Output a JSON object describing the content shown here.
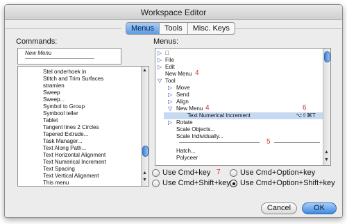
{
  "window": {
    "title": "Workspace Editor"
  },
  "tabs": [
    {
      "label": "Menus"
    },
    {
      "label": "Tools"
    },
    {
      "label": "Misc. Keys"
    }
  ],
  "commands": {
    "label": "Commands:",
    "new_menu": "New Menu",
    "items": [
      "Stel onderhoek in",
      "Stitch and Trim Surfaces",
      "stramien",
      "Sweep",
      "Sweep...",
      "Symbol to Group",
      "Symbool teller",
      "Tablet",
      "Tangent lines 2 Circles",
      "Tapered Extrude...",
      "Task Manager...",
      "Text Along Path...",
      "Text Horizontal Alignment",
      "Text Numerical Increment",
      "Text Spacing",
      "Text Vertical Alignment",
      "This menu"
    ]
  },
  "menus": {
    "label": "Menus:",
    "items": [
      {
        "text": "",
        "arrow": "right"
      },
      {
        "text": "File",
        "arrow": "right"
      },
      {
        "text": "Edit",
        "arrow": "right"
      },
      {
        "text": "New Menu",
        "marker": "4"
      },
      {
        "text": "Tool",
        "arrow": "down"
      },
      {
        "text": "Move",
        "arrow": "right"
      },
      {
        "text": "Send",
        "arrow": "right"
      },
      {
        "text": "Align",
        "arrow": "right"
      },
      {
        "text": "New Menu",
        "arrow": "down",
        "marker": "4"
      },
      {
        "text": "Text Numerical Increment",
        "shortcut": "⌥⇧⌘T",
        "marker": "6"
      },
      {
        "text": "Rotate",
        "arrow": "right"
      },
      {
        "text": "Scale Objects..."
      },
      {
        "text": "Scale Individually..."
      },
      {
        "separator": true,
        "marker": "5"
      },
      {
        "text": "Hatch..."
      },
      {
        "text": "Polyceer"
      }
    ]
  },
  "radios": {
    "marker": "7",
    "options": [
      {
        "label": "Use Cmd+key",
        "selected": false
      },
      {
        "label": "Use Cmd+Option+key",
        "selected": false
      },
      {
        "label": "Use Cmd+Shift+key",
        "selected": false
      },
      {
        "label": "Use Cmd+Option+Shift+key",
        "selected": true
      }
    ]
  },
  "buttons": {
    "cancel": "Cancel",
    "ok": "OK"
  },
  "colors": {
    "accent": "#5c9be4",
    "marker_red": "#d3302a",
    "highlight": "#c7d9f2"
  }
}
